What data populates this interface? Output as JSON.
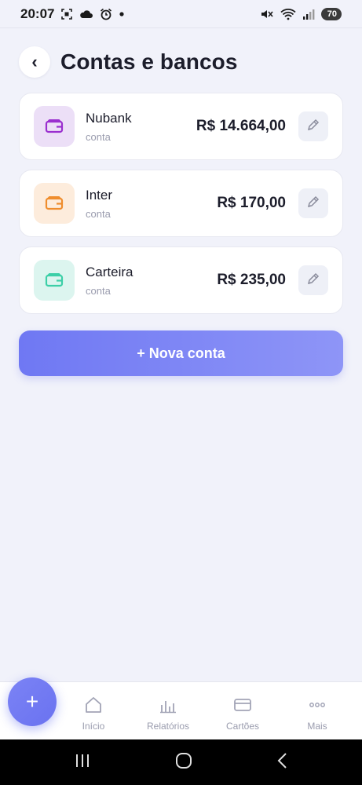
{
  "status_bar": {
    "time": "20:07",
    "battery": "70",
    "icons": [
      "screenshot-icon",
      "cloud-icon",
      "alarm-icon",
      "dot-icon",
      "mute-icon",
      "wifi-icon",
      "signal-icon",
      "battery-icon"
    ]
  },
  "header": {
    "back_symbol": "‹",
    "title": "Contas e bancos"
  },
  "accounts": [
    {
      "name": "Nubank",
      "type": "conta",
      "balance": "R$ 14.664,00",
      "icon_bg": "#ecdff7",
      "icon_color": "#9a2fcf"
    },
    {
      "name": "Inter",
      "type": "conta",
      "balance": "R$ 170,00",
      "icon_bg": "#fdecdc",
      "icon_color": "#ef8d2d"
    },
    {
      "name": "Carteira",
      "type": "conta",
      "balance": "R$ 235,00",
      "icon_bg": "#dcf5ef",
      "icon_color": "#3ccfa7"
    }
  ],
  "new_account_label": "+ Nova conta",
  "fab_label": "+",
  "bottom_nav": {
    "items": [
      {
        "label": "Início",
        "icon": "home-icon"
      },
      {
        "label": "Relatórios",
        "icon": "bar-chart-icon"
      },
      {
        "label": "Cartões",
        "icon": "card-icon"
      },
      {
        "label": "Mais",
        "icon": "more-icon"
      }
    ]
  },
  "colors": {
    "accent": "#7178f3",
    "background": "#f1f2fa"
  }
}
